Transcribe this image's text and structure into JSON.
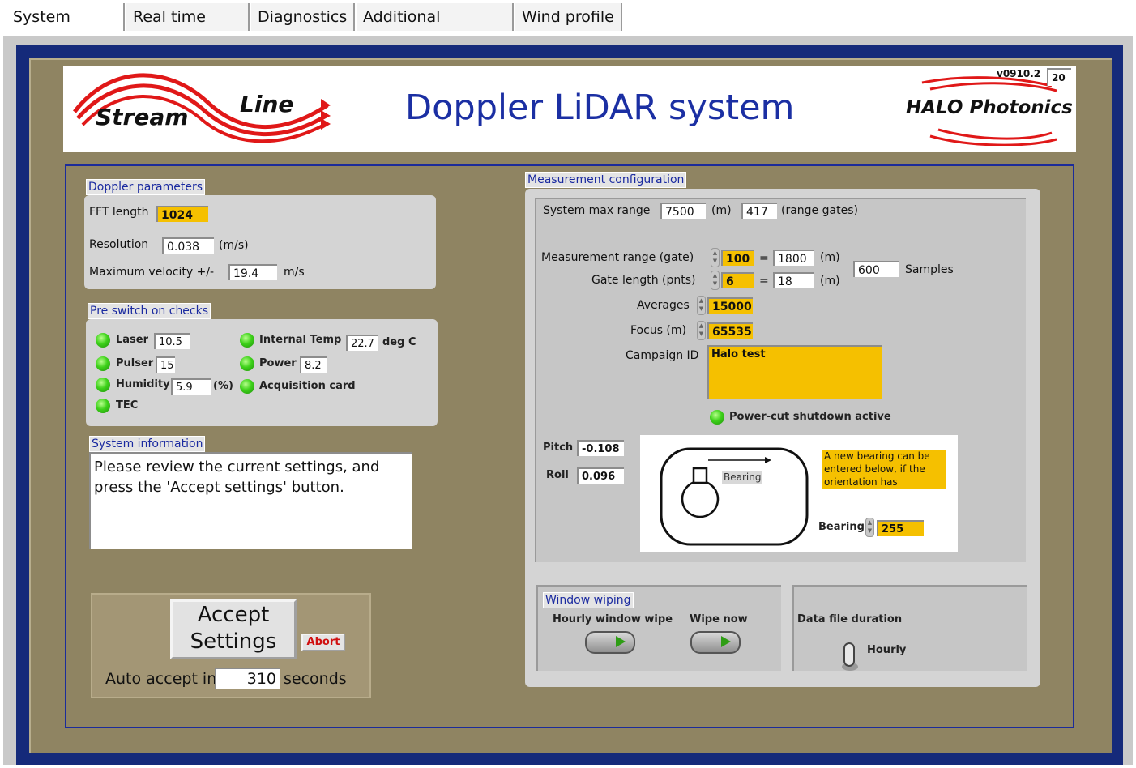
{
  "tabs": [
    "System setup",
    "Real time data",
    "Diagnostics",
    "Additional displays",
    "Wind profile"
  ],
  "banner": {
    "logo_left": {
      "word1": "Stream",
      "word2": "Line"
    },
    "title": "Doppler LiDAR system",
    "logo_right": "HALO Photonics",
    "version": "v0910.2",
    "version_box": "20"
  },
  "doppler": {
    "section": "Doppler parameters",
    "fft_label": "FFT length",
    "fft_value": "1024",
    "resolution_label": "Resolution",
    "resolution_value": "0.038",
    "resolution_unit": "(m/s)",
    "maxvel_label": "Maximum velocity +/-",
    "maxvel_value": "19.4",
    "maxvel_unit": "m/s"
  },
  "checks": {
    "section": "Pre switch on checks",
    "laser_label": "Laser",
    "laser_value": "10.5",
    "pulser_label": "Pulser",
    "pulser_value": "15",
    "humidity_label": "Humidity",
    "humidity_value": "5.9",
    "humidity_unit": "(%)",
    "tec_label": "TEC",
    "temp_label": "Internal Temp",
    "temp_value": "22.7",
    "temp_unit": "deg C",
    "power_label": "Power",
    "power_value": "8.2",
    "acq_label": "Acquisition card"
  },
  "sysinfo": {
    "section": "System information",
    "text": "Please review the current settings, and press the 'Accept settings' button."
  },
  "accept": {
    "line1": "Accept",
    "line2": "Settings",
    "abort": "Abort",
    "auto_label": "Auto accept in",
    "auto_value": "310",
    "auto_unit": "seconds"
  },
  "meas": {
    "section": "Measurement configuration",
    "maxrange_label": "System max range",
    "maxrange_value": "7500",
    "maxrange_unit": "(m)",
    "gates_value": "417",
    "gates_unit": "(range gates)",
    "range_label": "Measurement range (gate)",
    "range_gate": "100",
    "eq": "=",
    "range_m": "1800",
    "m_unit": "(m)",
    "gatelen_label": "Gate length (pnts)",
    "gatelen_value": "6",
    "gatelen_m": "18",
    "samples_value": "600",
    "samples_label": "Samples",
    "averages_label": "Averages",
    "averages_value": "15000",
    "focus_label": "Focus (m)",
    "focus_value": "65535",
    "campaign_label": "Campaign ID",
    "campaign_value": "Halo test",
    "powercut_label": "Power-cut shutdown active",
    "pitch_label": "Pitch",
    "pitch_value": "-0.108",
    "roll_label": "Roll",
    "roll_value": "0.096",
    "bearing_diagram_label": "Bearing",
    "bearing_note": "A new bearing can be entered below, if the orientation has changed.",
    "bearing_label": "Bearing",
    "bearing_value": "255"
  },
  "wiping": {
    "section": "Window wiping",
    "hourly_label": "Hourly window wipe",
    "now_label": "Wipe now"
  },
  "datafile": {
    "label": "Data file duration",
    "value": "Hourly"
  },
  "colors": {
    "accent_blue": "#1b2fa3",
    "field_yellow": "#f5c000",
    "led_green": "#3ed21a",
    "abort_red": "#d01010"
  }
}
